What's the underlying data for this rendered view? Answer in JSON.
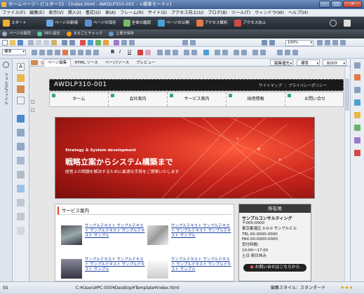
{
  "window": {
    "title": "ホームページ・ビルダー15 - [index.html - AWDLP310-001 - <標準モード>]",
    "min": "–",
    "max": "□",
    "close": "×"
  },
  "menu": [
    "ファイル(F)",
    "編集(E)",
    "表示(V)",
    "挿入(I)",
    "書式(O)",
    "表(A)",
    "フレーム(R)",
    "サイト(S)",
    "アクセス向上(U)",
    "ブログ(B)",
    "ツール(T)",
    "ウィンドウ(W)",
    "ヘルプ(H)"
  ],
  "mainbar": [
    "スタート",
    "ページの新規",
    "ページの保存",
    "全体の確認",
    "ページの公開",
    "アクセス解析",
    "アクセス向上"
  ],
  "subbar": [
    "ページの属性",
    "SEO 設定",
    "まるごとチェック",
    "上書き保存"
  ],
  "toolbar": {
    "style_select": "標準",
    "zoom": "100%",
    "edit_priority": "編集優先",
    "style2": "標準",
    "body_select": "BODY",
    "font_bold": "B",
    "font_italic": "I",
    "font_underline": "U"
  },
  "tabs": [
    "ページ編集",
    "HTML ソース",
    "ページ/ソース",
    "プレビュー"
  ],
  "left_panel_label": "フォルダ/ファイル",
  "site": {
    "logo": "AWDLP310-001",
    "top_links": "サイトマップ ｜ プライバシーポリシー",
    "nav": [
      "ホーム",
      "会社案内",
      "サービス案内",
      "採用情報",
      "お問い合せ"
    ],
    "hero_small": "Strategy & System development",
    "hero_title": "戦略立案からシステム構築まで",
    "hero_sub": "経営上の問題を解決するために最適な手段をご提案いたします",
    "services_heading": "サービス案内",
    "services": [
      "サンプルテキスト サンプルテキスト サンプルテキスト サンプルテキスト サンプル",
      "サンプルテキスト サンプルテキスト サンプルテキスト サンプルテキスト サンプル",
      "サンプルテキスト サンプルテキスト サンプルテキスト サンプルテキスト サンプル",
      "サンプルテキスト サンプルテキスト サンプルテキスト サンプルテキスト サンプル"
    ],
    "location_heading": "所在地",
    "company": "サンプルコンサルティング",
    "address_lines": [
      "〒000-0000",
      "東京都港区 0-0-0 サンプルビル",
      "TEL:00-0000-0000",
      "FAX:00-0000-0000",
      "受付時間:",
      "10:00～17:00",
      "土日:祝日休み"
    ],
    "contact_button": "お問い合せはこちらから"
  },
  "status": {
    "left": "SS",
    "path": "C:¥Users¥PC-050¥Desktop¥Template¥index.html",
    "style": "編集スタイル：スタンダード",
    "stars": "★★★"
  },
  "colors": {
    "accent": "#e53b20",
    "nav_bg": "#2a2a2a",
    "hero": "#c8241c"
  }
}
